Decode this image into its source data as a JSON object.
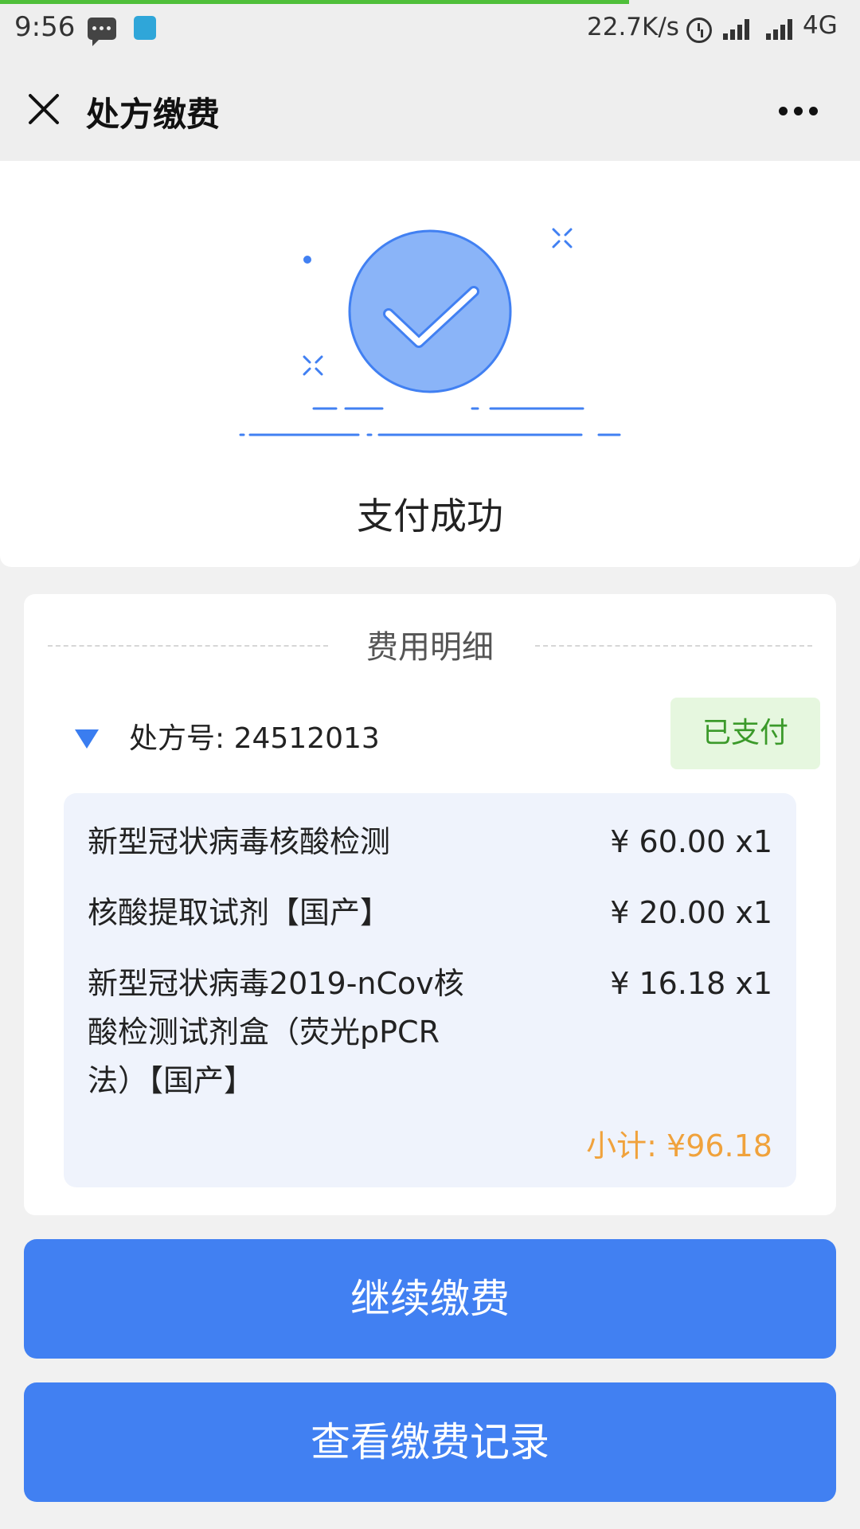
{
  "status_bar": {
    "time": "9:56",
    "net_speed": "22.7K/s",
    "network": "4G"
  },
  "title_bar": {
    "title": "处方缴费"
  },
  "success": {
    "message": "支付成功"
  },
  "details": {
    "section_title": "费用明细",
    "prescription_label": "处方号: 24512013",
    "status_badge": "已支付",
    "items": [
      {
        "name": "新型冠状病毒核酸检测",
        "price": "¥ 60.00 x1"
      },
      {
        "name": "核酸提取试剂【国产】",
        "price": "¥ 20.00 x1"
      },
      {
        "name_lines": [
          "新型冠状病毒2019-nCov核",
          "酸检测试剂盒（荧光pPCR",
          "法）【国产】"
        ],
        "price": "¥ 16.18 x1"
      }
    ],
    "subtotal": "小计: ¥96.18"
  },
  "buttons": {
    "continue_pay": "继续缴费",
    "view_records": "查看缴费记录"
  },
  "colors": {
    "primary": "#4180f2",
    "paid_bg": "#e6f7df",
    "paid_text": "#3b9a2a",
    "subtotal": "#f0a23c",
    "items_bg": "#eff3fc"
  }
}
